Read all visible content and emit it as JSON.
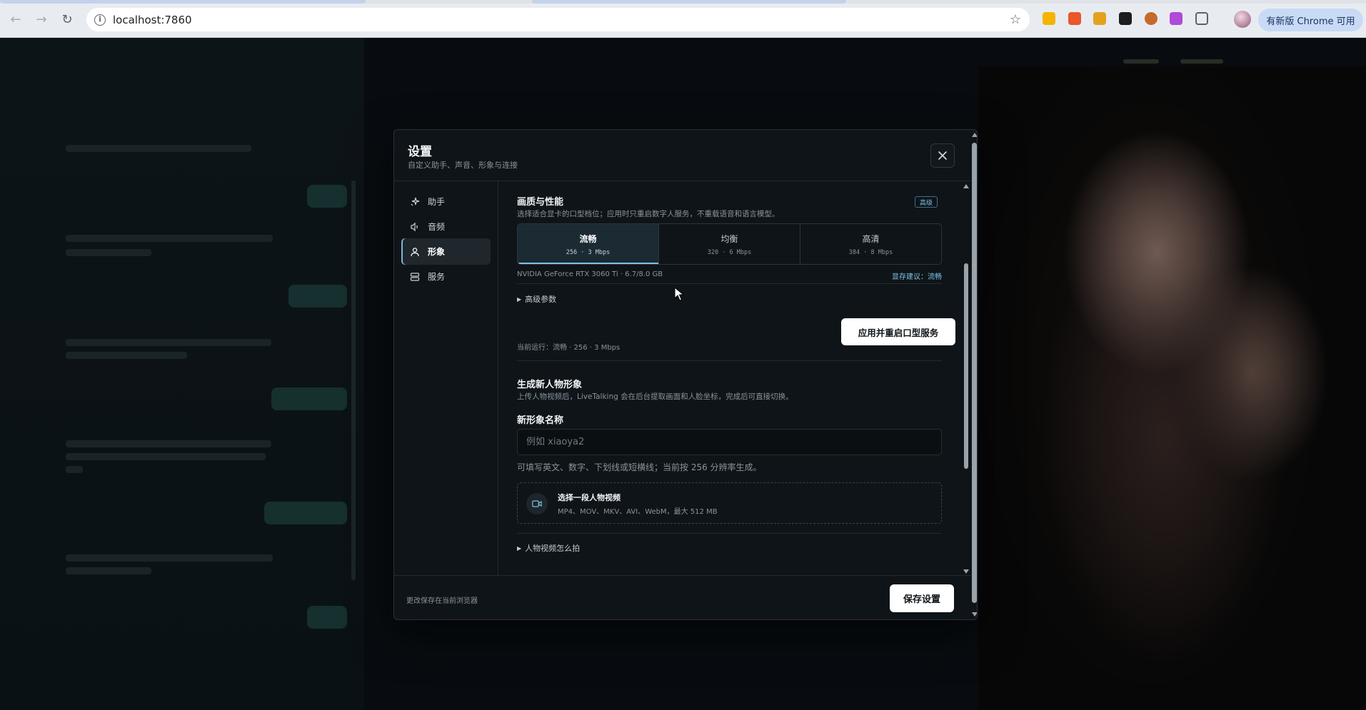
{
  "browser": {
    "url": "localhost:7860",
    "update_chip": "有新版 Chrome 可用"
  },
  "modal": {
    "title": "设置",
    "subtitle": "自定义助手、声音、形象与连接",
    "sidebar": [
      {
        "label": "助手",
        "icon": "sparkle-icon"
      },
      {
        "label": "音频",
        "icon": "speaker-icon"
      },
      {
        "label": "形象",
        "icon": "user-icon",
        "active": true
      },
      {
        "label": "服务",
        "icon": "server-icon"
      }
    ],
    "quality": {
      "title": "画质与性能",
      "desc": "选择适合显卡的口型档位；应用时只重启数字人服务，不重载语音和语言模型。",
      "badge": "高级",
      "options": [
        {
          "label": "流畅",
          "spec": "256 · 3 Mbps",
          "active": true
        },
        {
          "label": "均衡",
          "spec": "320 · 6 Mbps"
        },
        {
          "label": "高清",
          "spec": "384 · 8 Mbps"
        }
      ],
      "gpu": "NVIDIA GeForce RTX 3060 Ti · 6.7/8.0 GB",
      "vram_hint": "显存建议：流畅",
      "advanced": "高级参数",
      "running": "当前运行：流畅 · 256 · 3 Mbps",
      "apply_button": "应用并重启口型服务"
    },
    "avatar": {
      "title": "生成新人物形象",
      "desc": "上传人物视频后，LiveTalking 会在后台提取画面和人脸坐标，完成后可直接切换。",
      "name_label": "新形象名称",
      "name_placeholder": "例如 xiaoya2",
      "name_value": "",
      "hint": "可填写英文、数字、下划线或短横线；当前按 256 分辨率生成。",
      "upload_title": "选择一段人物视频",
      "upload_desc": "MP4、MOV、MKV、AVI、WebM，最大 512 MB",
      "howto": "人物视频怎么拍"
    },
    "footer_note": "更改保存在当前浏览器",
    "save_button": "保存设置"
  },
  "colors": {
    "accent": "#7fc2e3",
    "modal_bg": "#0f1418",
    "primary_button": "#ffffff"
  }
}
